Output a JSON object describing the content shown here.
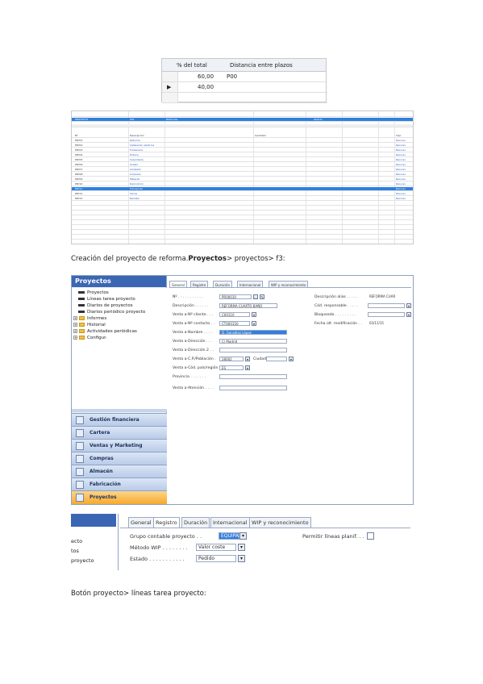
{
  "small_grid": {
    "col_pct": "% del total",
    "col_dist": "Distancia entre plazos",
    "rows": [
      {
        "pct": "60,00",
        "dist": "P00"
      },
      {
        "pct": "40,00",
        "dist": ""
      }
    ]
  },
  "big_grid": {
    "top_rows": [
      {
        "c1": "PROYECTO",
        "c2": "001",
        "c3": "Reformas",
        "c4": "Abierto"
      }
    ],
    "rows": [
      {
        "c1": "Nº",
        "c2": "Descripción",
        "c3": "Cantidad",
        "c4": "Tipo"
      },
      {
        "c1": "PRY01",
        "c2": "Reforma",
        "c3": "",
        "c4": "Recurso"
      },
      {
        "c1": "PRY02",
        "c2": "Instalación eléctrica",
        "c3": "",
        "c4": "Recurso"
      },
      {
        "c1": "PRY03",
        "c2": "Fontanería",
        "c3": "",
        "c4": "Recurso"
      },
      {
        "c1": "PRY04",
        "c2": "Pintura",
        "c3": "",
        "c4": "Recurso"
      },
      {
        "c1": "PRY05",
        "c2": "Carpintería",
        "c3": "",
        "c4": "Recurso"
      },
      {
        "c1": "PRY06",
        "c2": "Solado",
        "c3": "",
        "c4": "Recurso"
      },
      {
        "c1": "PRY07",
        "c2": "Alicatado",
        "c3": "",
        "c4": "Recurso"
      },
      {
        "c1": "PRY08",
        "c2": "Limpieza",
        "c3": "",
        "c4": "Recurso"
      },
      {
        "c1": "PRY09",
        "c2": "Material",
        "c3": "",
        "c4": "Recurso"
      },
      {
        "c1": "PRY10",
        "c2": "Demolición",
        "c3": "",
        "c4": "Recurso"
      },
      {
        "c1": "PRY11",
        "c2": "Transporte",
        "c3": "",
        "c4": "Recurso"
      },
      {
        "c1": "PRY12",
        "c2": "Varios",
        "c3": "",
        "c4": "Recurso"
      },
      {
        "c1": "PRY13",
        "c2": "Remate",
        "c3": "",
        "c4": "Recurso"
      }
    ]
  },
  "heading1": {
    "prefix": "Creación del proyecto de reforma.",
    "bold": "Proyectos",
    "suffix": "> proyectos> f3:"
  },
  "window": {
    "nav_title": "Proyectos",
    "tree": [
      {
        "label": "Proyectos",
        "type": "doc"
      },
      {
        "label": "Líneas tarea proyecto",
        "type": "doc"
      },
      {
        "label": "Diarios de proyectos",
        "type": "doc"
      },
      {
        "label": "Diarios periódico proyecto",
        "type": "doc"
      },
      {
        "label": "Informes",
        "type": "folder"
      },
      {
        "label": "Historial",
        "type": "folder"
      },
      {
        "label": "Actividades periódicas",
        "type": "folder"
      },
      {
        "label": "Configur.",
        "type": "folder"
      }
    ],
    "modules": [
      "Gestión financiera",
      "Cartera",
      "Ventas y Marketing",
      "Compras",
      "Almacén",
      "Fabricación",
      "Proyectos"
    ],
    "tabs": [
      "General",
      "Registro",
      "Duración",
      "Internacional",
      "WIP y reconocimiento"
    ],
    "left_fields": [
      {
        "label": "Nº . . . . . . . . . . .",
        "value": "PR00010"
      },
      {
        "label": "Descripción . . . . . .",
        "value": "REFORMA CUARTO BAÑO"
      },
      {
        "label": "Venta a-Nº cliente . . .",
        "value": "C00110"
      },
      {
        "label": "Venta a-Nº contacto . .",
        "value": "CT000150"
      },
      {
        "label": "Venta a-Nombre . . . .",
        "value": "D. González López"
      },
      {
        "label": "Venta a-Dirección . . .",
        "value": "C/ Madrid"
      },
      {
        "label": "Venta a-Dirección 2 . .",
        "value": ""
      },
      {
        "label": "Venta a-C.P./Población .",
        "value": "28002"
      },
      {
        "label": "Venta a-Cód. país/región",
        "value": "ES"
      },
      {
        "label": "Provincia . . . . . . .",
        "value": ""
      },
      {
        "label": "Venta a-Atención . . . .",
        "value": ""
      }
    ],
    "ciudad_label": "Ciudad",
    "right_fields": [
      {
        "label": "Descripción alias . . . . .",
        "value": "REFORMA CUAR"
      },
      {
        "label": "Cód. responsable . . . . .",
        "value": ""
      },
      {
        "label": "Bloqueado . . . . . . . . .",
        "value": ""
      },
      {
        "label": "Fecha últ. modificación . .",
        "value": "03/11/15"
      }
    ]
  },
  "registro": {
    "nav_items": [
      "ecto",
      "tos",
      "proyecto"
    ],
    "tabs": [
      "General",
      "Registro",
      "Duración",
      "Internacional",
      "WIP y reconocimiento"
    ],
    "fields": [
      {
        "label": "Grupo contable proyecto . .",
        "value": "EQUIPAS"
      },
      {
        "label": "Método WIP . . . . . . . .",
        "value": "Valor coste"
      },
      {
        "label": "Estado . . . . . . . . . . .",
        "value": "Pedido"
      }
    ],
    "right_label": "Permitir líneas planif. . ."
  },
  "heading2": "Botón proyecto> líneas tarea proyecto:"
}
